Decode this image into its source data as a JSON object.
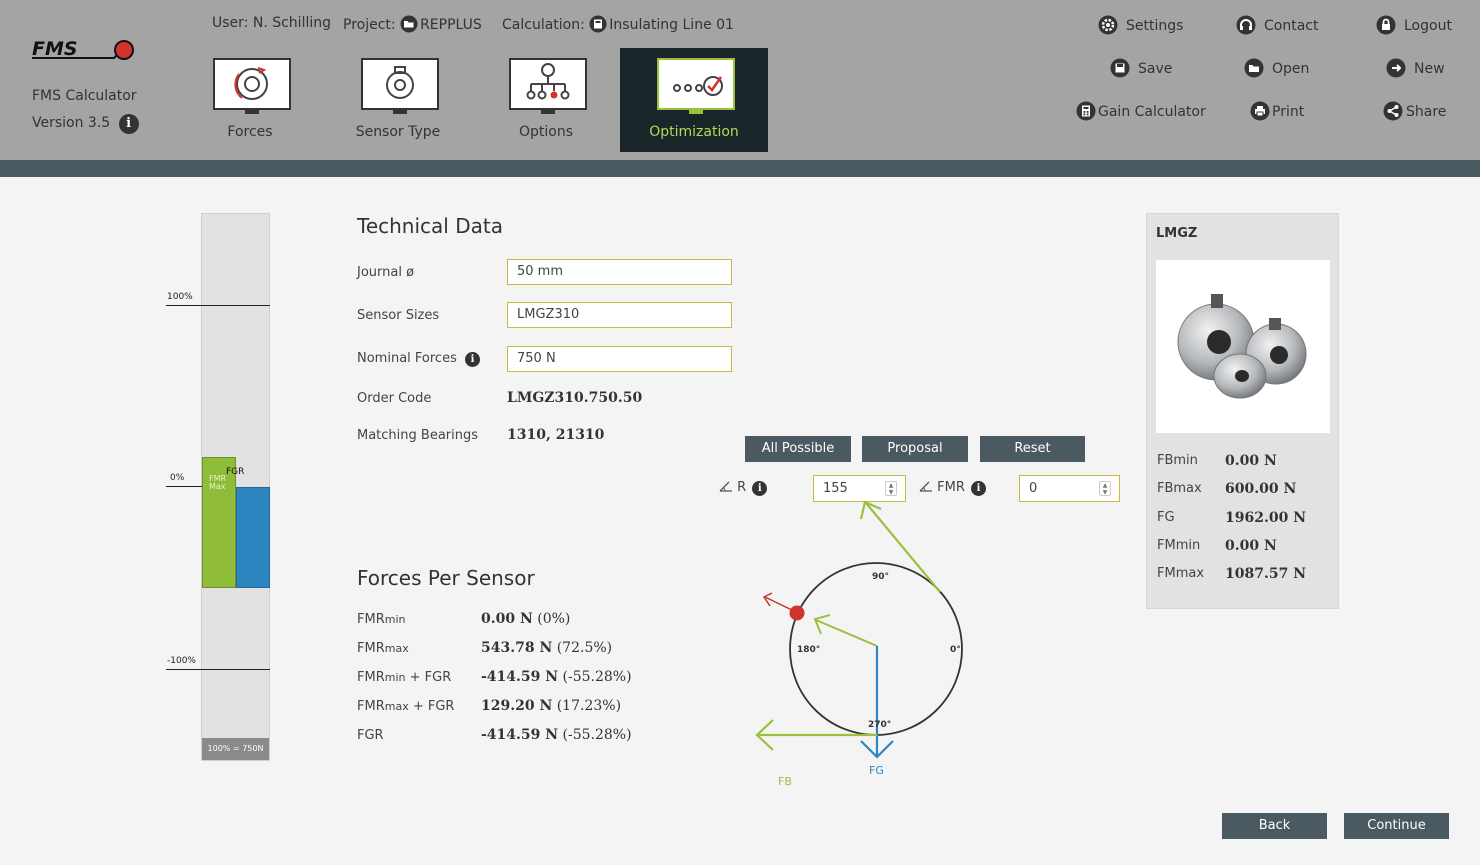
{
  "app": {
    "name": "FMS Calculator",
    "version": "Version 3.5",
    "logo_text": "FMS"
  },
  "session": {
    "user_label": "User:",
    "user": "N. Schilling",
    "project_label": "Project:",
    "project": "REPPLUS",
    "calc_label": "Calculation:",
    "calc": "Insulating Line 01"
  },
  "nav_tabs": [
    {
      "label": "Forces"
    },
    {
      "label": "Sensor Type"
    },
    {
      "label": "Options"
    },
    {
      "label": "Optimization"
    }
  ],
  "header_buttons": {
    "settings": "Settings",
    "contact": "Contact",
    "logout": "Logout",
    "save": "Save",
    "open": "Open",
    "new": "New",
    "gain": "Gain Calculator",
    "print": "Print",
    "share": "Share"
  },
  "gauge": {
    "top_label": "100%",
    "zero_label": "0%",
    "bottom_label": "-100%",
    "bar1_label_a": "FMR",
    "bar1_label_b": "Max",
    "bar2_label": "FGR",
    "footer": "100% = 750N",
    "fmr_max_pct": 72.5,
    "fgr_pct": -55.28
  },
  "technical": {
    "title": "Technical Data",
    "journal_label": "Journal ø",
    "journal_value": "50 mm",
    "sizes_label": "Sensor Sizes",
    "sizes_value": "LMGZ310",
    "nominal_label": "Nominal Forces",
    "nominal_value": "750 N",
    "order_label": "Order Code",
    "order_value": "LMGZ310.750.50",
    "bearings_label": "Matching Bearings",
    "bearings_value": "1310, 21310"
  },
  "forces": {
    "title": "Forces Per Sensor",
    "rows": [
      {
        "label_main": "FMR",
        "label_sub": "min",
        "label_suffix": "",
        "value": "0.00 N",
        "pct": "(0%)"
      },
      {
        "label_main": "FMR",
        "label_sub": "max",
        "label_suffix": "",
        "value": "543.78 N",
        "pct": "(72.5%)"
      },
      {
        "label_main": "FMR",
        "label_sub": "min",
        "label_suffix": " + FGR",
        "value": "-414.59 N",
        "pct": "(-55.28%)"
      },
      {
        "label_main": "FMR",
        "label_sub": "max",
        "label_suffix": " + FGR",
        "value": "129.20 N",
        "pct": "(17.23%)"
      },
      {
        "label_main": "FGR",
        "label_sub": "",
        "label_suffix": "",
        "value": "-414.59 N",
        "pct": "(-55.28%)"
      }
    ]
  },
  "optimization": {
    "btn_all": "All Possible",
    "btn_proposal": "Proposal",
    "btn_reset": "Reset",
    "angle_r_label": "R",
    "angle_r_value": "155",
    "angle_fmr_label": "FMR",
    "angle_fmr_value": "0",
    "deg90": "90°",
    "deg180": "180°",
    "deg0": "0°",
    "deg270": "270°",
    "fb_label": "FB",
    "fg_label": "FG"
  },
  "sensor_panel": {
    "title": "LMGZ",
    "rows": [
      {
        "label": "FBmin",
        "value": "0.00 N"
      },
      {
        "label": "FBmax",
        "value": "600.00 N"
      },
      {
        "label": "FG",
        "value": "1962.00 N"
      },
      {
        "label": "FMmin",
        "value": "0.00 N"
      },
      {
        "label": "FMmax",
        "value": "1087.57 N"
      }
    ]
  },
  "footer": {
    "back": "Back",
    "continue": "Continue"
  },
  "colors": {
    "header": "#a4a4a4",
    "stripe": "#4b5a60",
    "active_tab": "#1a2529",
    "accent_green": "#9bc13c",
    "blue": "#2e86c1",
    "red": "#d0342c"
  }
}
